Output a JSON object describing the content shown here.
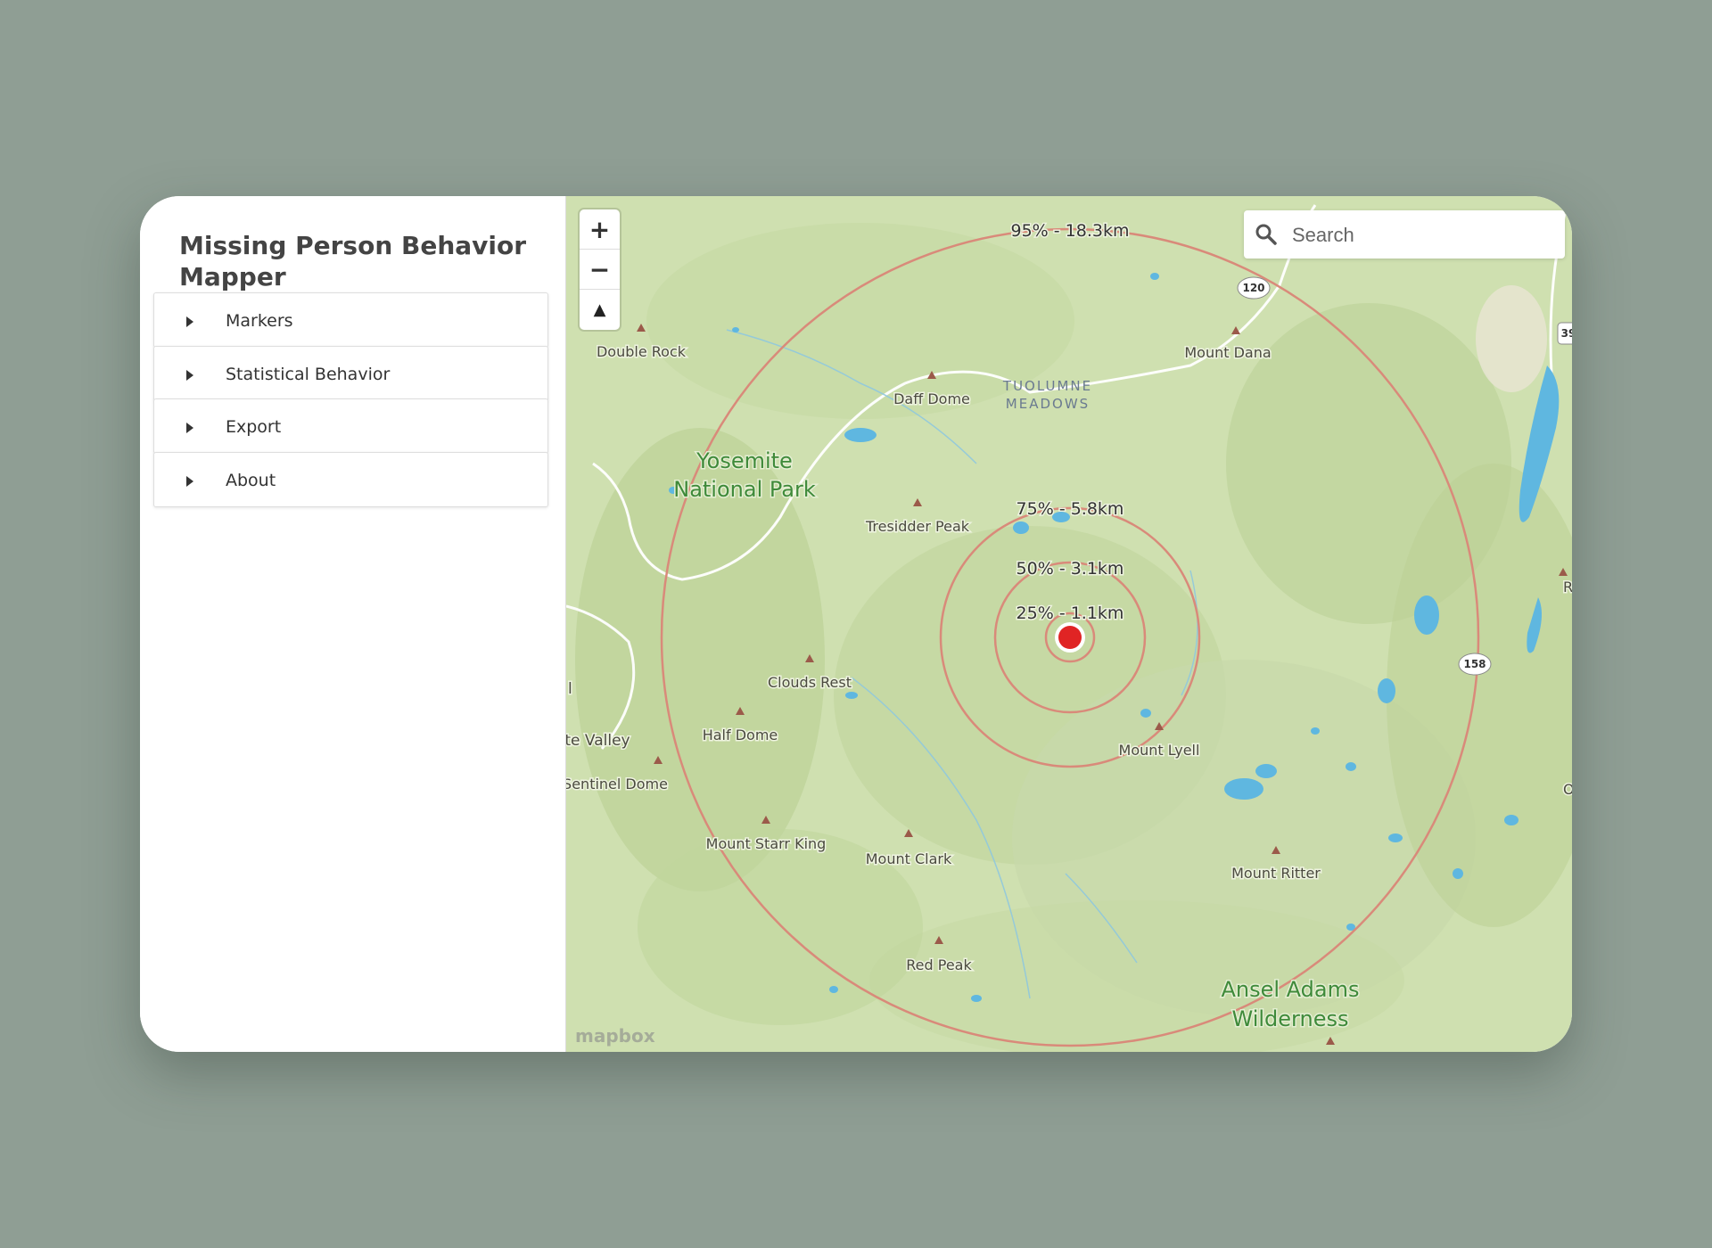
{
  "app": {
    "title": "Missing Person Behavior Mapper"
  },
  "sidebar": {
    "panels": [
      {
        "label": "Markers"
      },
      {
        "label": "Statistical Behavior"
      },
      {
        "label": "Export"
      },
      {
        "label": "About"
      }
    ]
  },
  "map": {
    "zoom_in_label": "+",
    "zoom_out_label": "−",
    "compass_label": "▲",
    "search": {
      "placeholder": "Search",
      "value": ""
    },
    "attribution": "mapbox",
    "rings": [
      {
        "label": "95% - 18.3km",
        "percentile": 95,
        "distance_km": 18.3
      },
      {
        "label": "75% - 5.8km",
        "percentile": 75,
        "distance_km": 5.8
      },
      {
        "label": "50% - 3.1km",
        "percentile": 50,
        "distance_km": 3.1
      },
      {
        "label": "25% - 1.1km",
        "percentile": 25,
        "distance_km": 1.1
      }
    ],
    "place_labels": {
      "double_rock": "Double Rock",
      "daff_dome": "Daff Dome",
      "tuolumne_line1": "TUOLUMNE",
      "tuolumne_line2": "MEADOWS",
      "mount_dana": "Mount Dana",
      "yosemite_line1": "Yosemite",
      "yosemite_line2": "National Park",
      "tresidder_peak": "Tresidder Peak",
      "clouds_rest": "Clouds Rest",
      "half_dome": "Half Dome",
      "valley": "te Valley",
      "sentinel_dome": "Sentinel Dome",
      "mount_starr_king": "Mount Starr King",
      "mount_clark": "Mount Clark",
      "red_peak": "Red Peak",
      "mount_lyell": "Mount Lyell",
      "mount_ritter": "Mount Ritter",
      "ansel_line1": "Ansel Adams",
      "ansel_line2": "Wilderness",
      "reversed": "Reversed",
      "owe": "Owe",
      "l_edge": "l"
    },
    "road_shields": {
      "hwy120": "120",
      "hwy158": "158",
      "hwy395": "39"
    },
    "colors": {
      "marker": "#e02424",
      "ring": "#d98a7a",
      "land": "#cfe0b0",
      "water": "#5fb7e0",
      "park_label": "#3f8a3a"
    }
  }
}
